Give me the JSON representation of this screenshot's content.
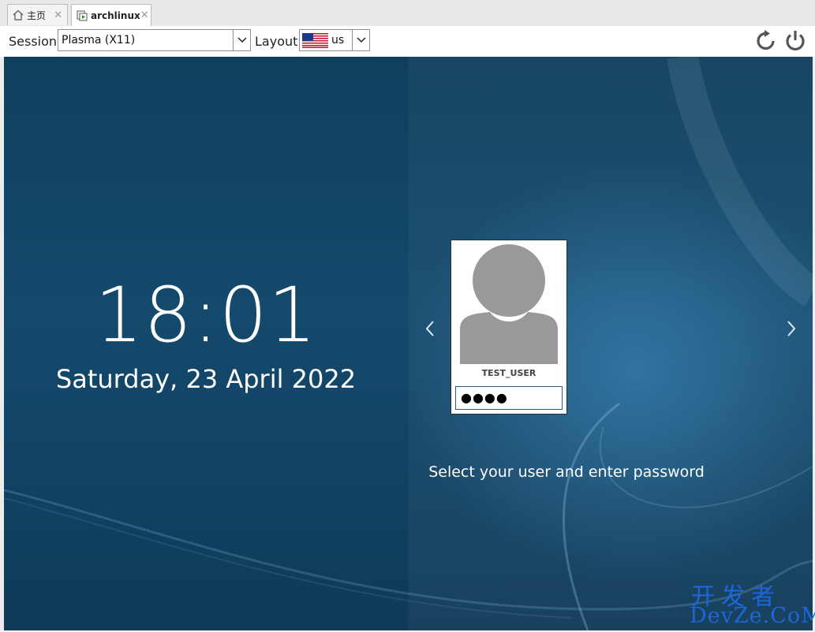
{
  "tabs": [
    {
      "label": "主页",
      "icon": "home-icon",
      "active": false
    },
    {
      "label": "archlinux",
      "icon": "vm-icon",
      "active": true
    }
  ],
  "toolbar": {
    "session_label": "Session",
    "session_value": "Plasma (X11)",
    "layout_label": "Layout",
    "layout_value": "us",
    "layout_flag": "us-flag-icon",
    "actions": [
      "restart-icon",
      "power-icon"
    ]
  },
  "login": {
    "time": "18:01",
    "date": "Saturday, 23 April 2022",
    "username": "TEST_USER",
    "password_mask": "●●●●",
    "hint": "Select your user and enter password"
  },
  "watermark": {
    "line1": "开发者",
    "line2": "DevZe.CoM"
  },
  "colors": {
    "background_top": "#0f3f5d",
    "accent_blue": "#1e66d8",
    "text_white": "#ffffff"
  }
}
